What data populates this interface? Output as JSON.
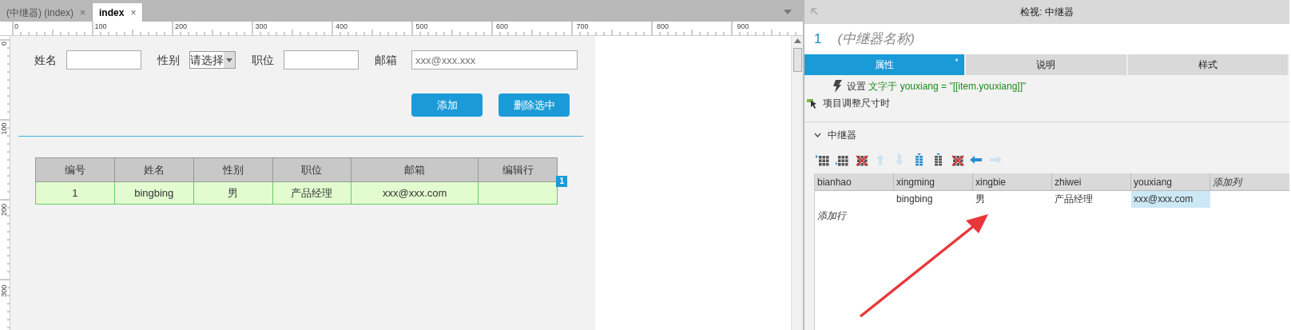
{
  "doc_tabs": [
    {
      "label": "(中继器) (index)",
      "close": "×",
      "selected": false
    },
    {
      "label": "index",
      "close": "×",
      "selected": true
    }
  ],
  "ruler": {
    "x_labels": [
      "0",
      "100",
      "200",
      "300",
      "400",
      "500",
      "600",
      "700",
      "800",
      "900"
    ],
    "y_labels": [
      "0",
      "100",
      "200",
      "300"
    ]
  },
  "form": {
    "fields": [
      {
        "label": "姓名",
        "kind": "text"
      },
      {
        "label": "性别",
        "kind": "select",
        "value": "请选择"
      },
      {
        "label": "职位",
        "kind": "text"
      },
      {
        "label": "邮箱",
        "kind": "text",
        "placeholder": "xxx@xxx.xxx"
      }
    ],
    "buttons": [
      "添加",
      "删除选中"
    ]
  },
  "table": {
    "columns": [
      "编号",
      "姓名",
      "性别",
      "职位",
      "邮箱",
      "编辑行"
    ],
    "rows": [
      {
        "cells": [
          "1",
          "bingbing",
          "男",
          "产品经理",
          "xxx@xxx.com"
        ],
        "selected": true,
        "marker": "1"
      }
    ]
  },
  "inspector": {
    "title": "检视: 中继器",
    "number": "1",
    "name": "(中继器名称)",
    "tabs": [
      {
        "label": "属性",
        "selected": true,
        "mark": "*"
      },
      {
        "label": "说明",
        "selected": false
      },
      {
        "label": "样式",
        "selected": false
      }
    ],
    "action": {
      "verb": "设置",
      "detail": "文字于 youxiang = \"[[item.youxiang]]\""
    },
    "event": "项目调整尺寸时",
    "section": {
      "title": "中继器",
      "expanded": true
    },
    "toolbar": [
      {
        "kind": "grid-left",
        "disabled": false
      },
      {
        "kind": "grid-right",
        "disabled": false
      },
      {
        "kind": "grid-delete",
        "disabled": false
      },
      {
        "kind": "up",
        "disabled": true
      },
      {
        "kind": "down",
        "disabled": true
      },
      {
        "kind": "grid-top",
        "disabled": false
      },
      {
        "kind": "grid-bottom",
        "disabled": false
      },
      {
        "kind": "grid-delete",
        "disabled": false
      },
      {
        "kind": "left",
        "disabled": false
      },
      {
        "kind": "right",
        "disabled": true
      }
    ],
    "grid": {
      "columns": [
        "bianhao",
        "xingming",
        "xingbie",
        "zhiwei",
        "youxiang"
      ],
      "add_column": "添加列",
      "rows": [
        {
          "cells": [
            {
              "selected": false
            },
            {
              "text": "bingbing",
              "selected": false
            },
            {
              "text": "男",
              "selected": false
            },
            {
              "text": "产品经理",
              "selected": false
            },
            {
              "text": "xxx@xxx.com",
              "selected": true
            }
          ]
        }
      ],
      "add_row": "添加行"
    }
  }
}
